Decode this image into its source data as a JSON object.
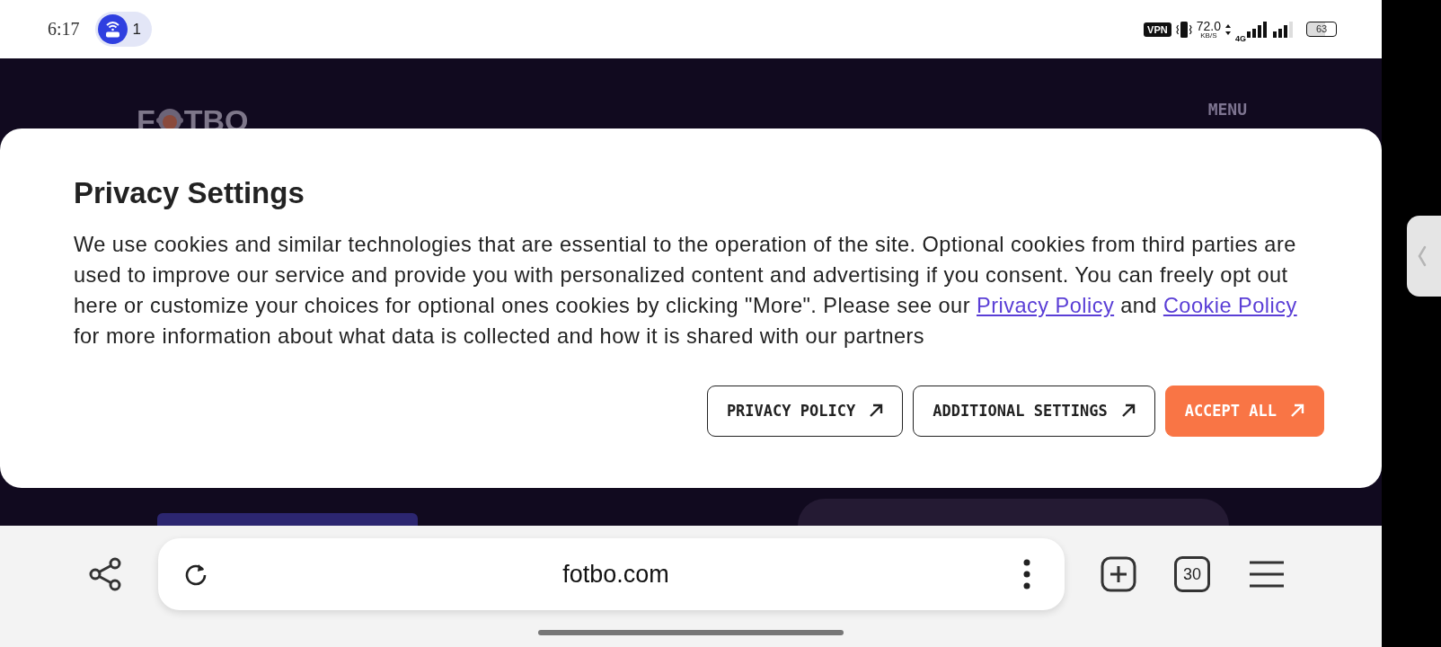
{
  "status_bar": {
    "time": "6:17",
    "notification_count": "1",
    "vpn": "VPN",
    "speed": "72.0",
    "speed_unit": "KB/S",
    "network": "4G",
    "battery": "63"
  },
  "site": {
    "logo_start": "F",
    "logo_end": "TBO",
    "menu": "MENU"
  },
  "dialog": {
    "title": "Privacy Settings",
    "body": [
      {
        "kind": "text",
        "text": "We use cookies and similar technologies that are essential to the operation of the site. Optional cookies from third parties are used to improve our service and provide you with personalized content and advertising if you consent. You can freely opt out here or customize your choices for optional ones cookies by clicking \"More\". Please see our "
      },
      {
        "kind": "link",
        "text": "Privacy Policy"
      },
      {
        "kind": "text",
        "text": " and "
      },
      {
        "kind": "link",
        "text": "Cookie Policy"
      },
      {
        "kind": "text",
        "text": " for more information about what data is collected and how it is shared with our partners"
      }
    ],
    "buttons": [
      {
        "label": "PRIVACY POLICY",
        "kind": "outline"
      },
      {
        "label": "ADDITIONAL SETTINGS",
        "kind": "outline"
      },
      {
        "label": "ACCEPT ALL",
        "kind": "primary"
      }
    ]
  },
  "browser_bar": {
    "url": "fotbo.com",
    "tab_count": "30"
  }
}
